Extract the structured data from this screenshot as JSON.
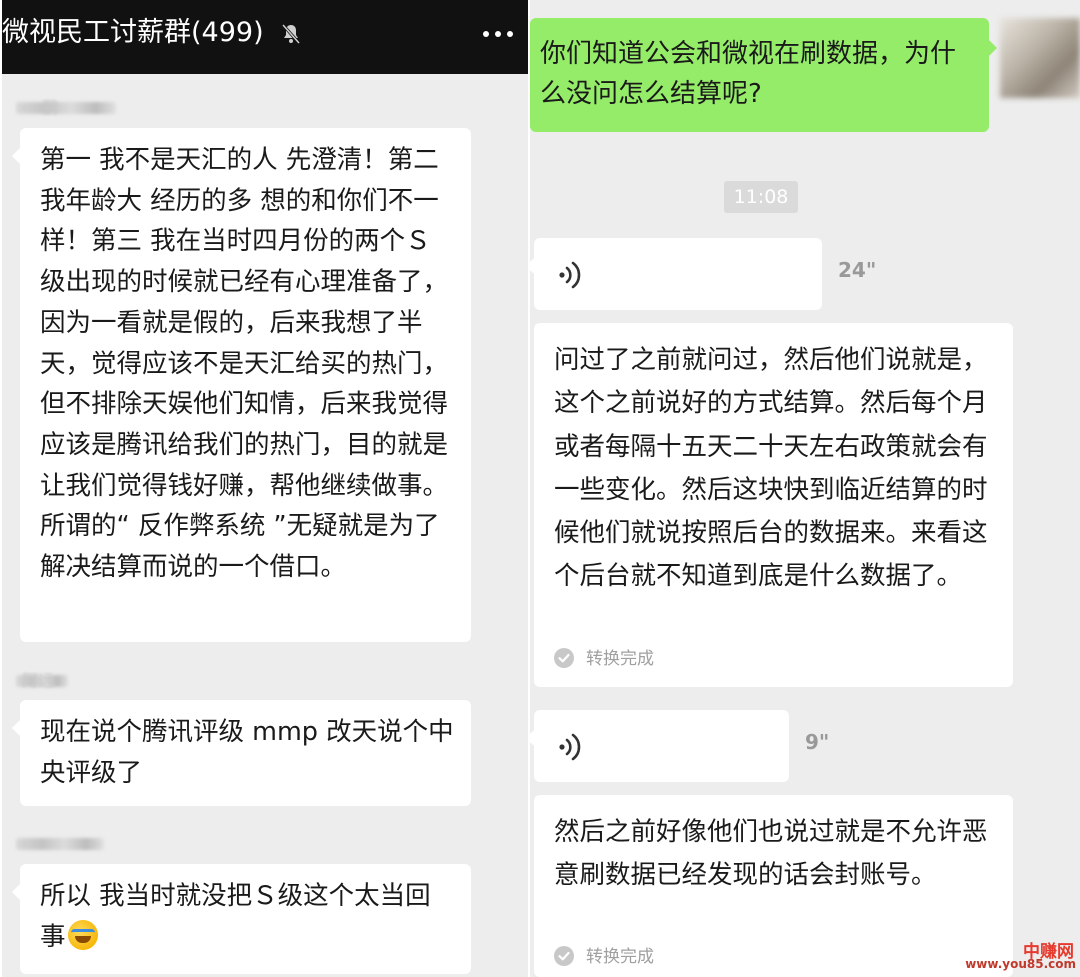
{
  "left": {
    "header": {
      "title": "微视民工讨薪群(499)",
      "mute_icon": "bell-muted-icon",
      "more_icon": "more-dots-icon"
    },
    "messages": [
      {
        "sender": "· · 鹏",
        "text": "第一 我不是天汇的人 先澄清！第二 我年龄大 经历的多 想的和你们不一样！第三 我在当时四月份的两个Ｓ级出现的时候就已经有心理准备了，因为一看就是假的，后来我想了半天，觉得应该不是天汇给买的热门，但不排除天娱他们知情，后来我觉得应该是腾讯给我们的热门，目的就是让我们觉得钱好赚，帮他继续做事。所谓的“ 反作弊系统 ”无疑就是为了解决结算而说的一个借口。"
      },
      {
        "sender": "阿远",
        "text": "现在说个腾讯评级 mmp 改天说个中央评级了"
      },
      {
        "sender": "· · ·",
        "text": "所以 我当时就没把Ｓ级这个太当回事",
        "emoji": "crying-laughing-face-icon"
      }
    ]
  },
  "right": {
    "avatar_icon": "avatar-icon",
    "outgoing": {
      "text": "你们知道公会和微视在刷数据，为什么没问怎么结算呢?"
    },
    "time": "11:08",
    "voice_messages": [
      {
        "duration": "24\"",
        "transcript": "问过了之前就问过，然后他们说就是，这个之前说好的方式结算。然后每个月或者每隔十五天二十天左右政策就会有一些变化。然后这块快到临近结算的时候他们就说按照后台的数据来。来看这个后台就不知道到底是什么数据了。",
        "status": "转换完成"
      },
      {
        "duration": "9\"",
        "transcript": "然后之前好像他们也说过就是不允许恶意刷数据已经发现的话会封账号。",
        "status": "转换完成"
      }
    ]
  },
  "watermark": {
    "name": "中赚网",
    "url": "www.you85.com"
  },
  "colors": {
    "header_bg": "#111111",
    "chat_bg": "#ededed",
    "bubble_in": "#ffffff",
    "bubble_out": "#95ec69",
    "meta_gray": "#a0a0a0",
    "watermark_red": "#e63a2e"
  }
}
